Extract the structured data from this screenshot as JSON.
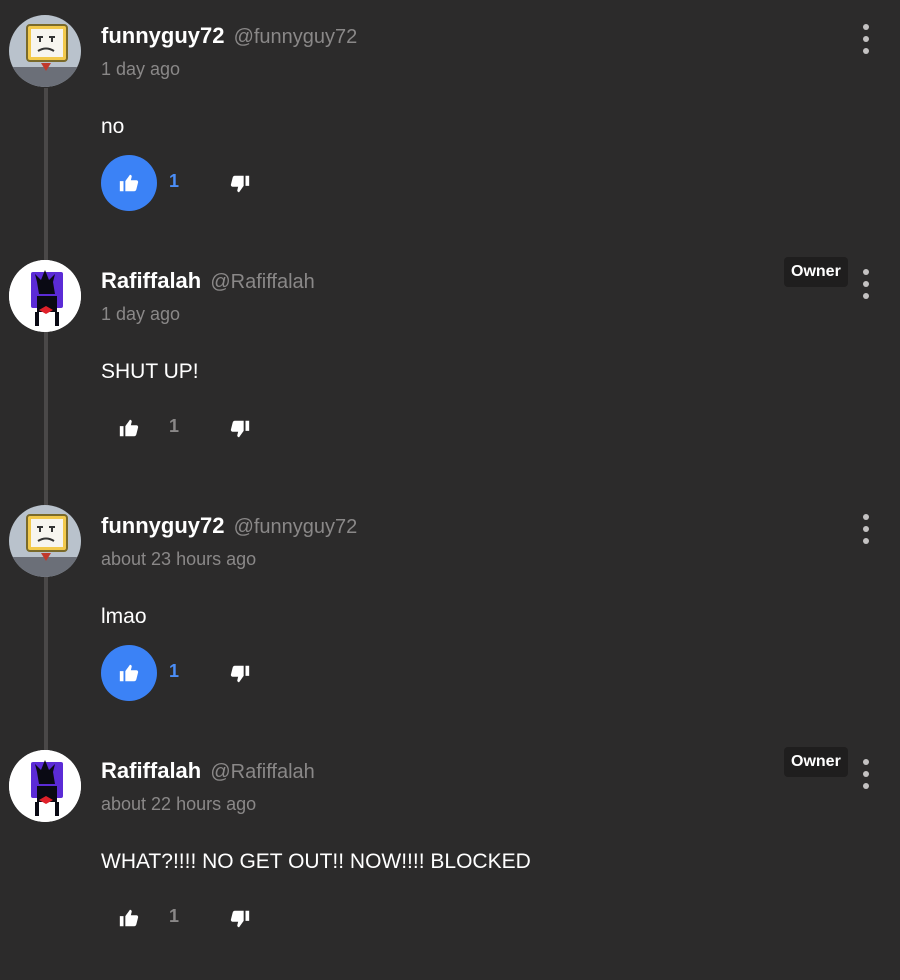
{
  "comments": [
    {
      "display_name": "funnyguy72",
      "handle": "@funnyguy72",
      "time": "1 day ago",
      "text": "no",
      "likes": "1",
      "liked": true,
      "badge": null,
      "avatar": "yellow-box-character-icon"
    },
    {
      "display_name": "Rafiffalah",
      "handle": "@Rafiffalah",
      "time": "1 day ago",
      "text": "SHUT UP!",
      "likes": "1",
      "liked": false,
      "badge": "Owner",
      "avatar": "purple-box-character-icon"
    },
    {
      "display_name": "funnyguy72",
      "handle": "@funnyguy72",
      "time": "about 23 hours ago",
      "text": "lmao",
      "likes": "1",
      "liked": true,
      "badge": null,
      "avatar": "yellow-box-character-icon"
    },
    {
      "display_name": "Rafiffalah",
      "handle": "@Rafiffalah",
      "time": "about 22 hours ago",
      "text": "WHAT?!!!! NO GET OUT!! NOW!!!! BLOCKED",
      "likes": "1",
      "liked": false,
      "badge": "Owner",
      "avatar": "purple-box-character-icon"
    }
  ],
  "colors": {
    "background": "#2c2b2b",
    "accent": "#3b82f6",
    "muted": "#8a8888"
  }
}
